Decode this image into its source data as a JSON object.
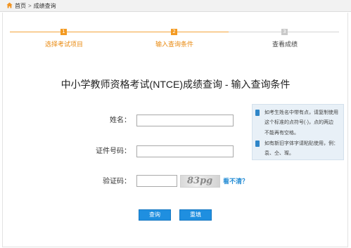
{
  "breadcrumb": {
    "home": "首页",
    "separator": ">",
    "current": "成绩查询"
  },
  "steps": [
    {
      "number": "1",
      "label": "选择考试项目"
    },
    {
      "number": "2",
      "label": "输入查询条件"
    },
    {
      "number": "3",
      "label": "查看成绩"
    }
  ],
  "title": "中小学教师资格考试(NTCE)成绩查询 - 输入查询条件",
  "form": {
    "name_label": "姓名：",
    "name_value": "",
    "id_label": "证件号码：",
    "id_value": "",
    "captcha_label": "验证码：",
    "captcha_value": "",
    "captcha_text": "83pg",
    "refresh_label": "看不清？"
  },
  "buttons": {
    "query": "查询",
    "reset": "重填"
  },
  "tips": {
    "name_tip": [
      "如考生姓名中带有点，请复制使用",
      "这个标准的点符号(·)，点的两边",
      "不能再有空格。"
    ],
    "char_tip": [
      "如有新旧字体字请粘贴使用，例：",
      "袁、仝、璨。"
    ]
  },
  "colors": {
    "accent": "#f39a21",
    "primary": "#1f8fe0",
    "link": "#2a8fd6",
    "tip_bg": "#e8f0f7"
  }
}
